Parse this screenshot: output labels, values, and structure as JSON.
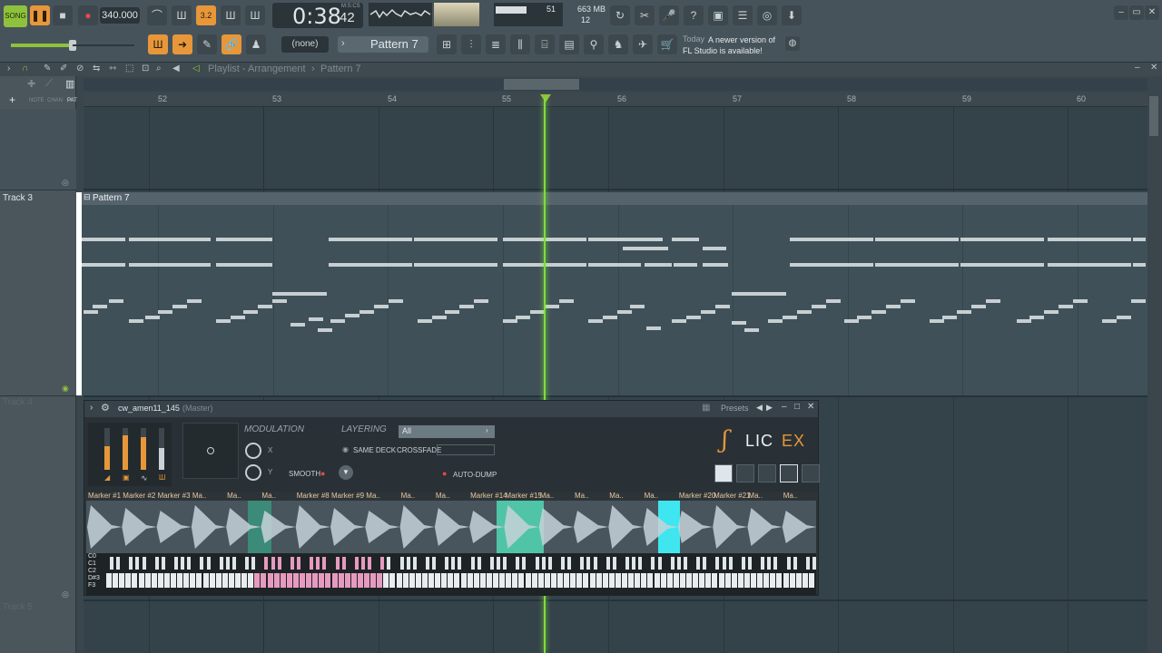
{
  "toolbar": {
    "song_label": "SONG",
    "tempo": "340.000",
    "time_big": "0:38",
    "time_small": "42",
    "time_unit": "M:S:CS",
    "cpu_value": "51",
    "memory": "663 MB",
    "polyphony": "12",
    "snap": "(none)",
    "pattern": "Pattern 7",
    "news_day": "Today",
    "news_text": "A newer version of FL Studio is available!"
  },
  "playlist": {
    "breadcrumb": "Playlist - Arrangement",
    "breadcrumb_pattern": "Pattern 7",
    "tabs": [
      "NOTE",
      "CHAN",
      "PAT"
    ],
    "ruler": [
      "52",
      "53",
      "54",
      "55",
      "56",
      "57",
      "58",
      "59",
      "60"
    ],
    "tracks": [
      "Track 3",
      "Track 4",
      "Track 5"
    ],
    "clip_label": "Pattern 7"
  },
  "slicex": {
    "title": "cw_amen11_145",
    "title_suffix": "(Master)",
    "presets": "Presets",
    "modulation": "MODULATION",
    "mod_x": "X",
    "mod_y": "Y",
    "smooth": "SMOOTH",
    "layering": "LAYERING",
    "layer_value": "All",
    "same_deck": "SAME DECK",
    "crossfade": "CROSSFADE",
    "auto_dump": "AUTO-DUMP",
    "logo": "SLICEX",
    "markers": [
      "Marker #1",
      "Marker #2",
      "Marker #3",
      "Ma..",
      "Ma..",
      "Ma..",
      "Marker #8",
      "Marker #9",
      "Ma..",
      "Ma..",
      "Ma..",
      "Marker #14",
      "Marker #15",
      "Ma..",
      "Ma..",
      "Ma..",
      "Ma..",
      "Marker #20",
      "Marker #21",
      "Ma..",
      "Ma.."
    ],
    "octaves": [
      "C0",
      "C1",
      "C2",
      "D#3",
      "F3"
    ]
  },
  "colors": {
    "accent": "#e7973a",
    "playhead": "#7edc3a",
    "highlight_slice": "#4fe0c0",
    "cyan_slice": "#3fe6f0"
  }
}
